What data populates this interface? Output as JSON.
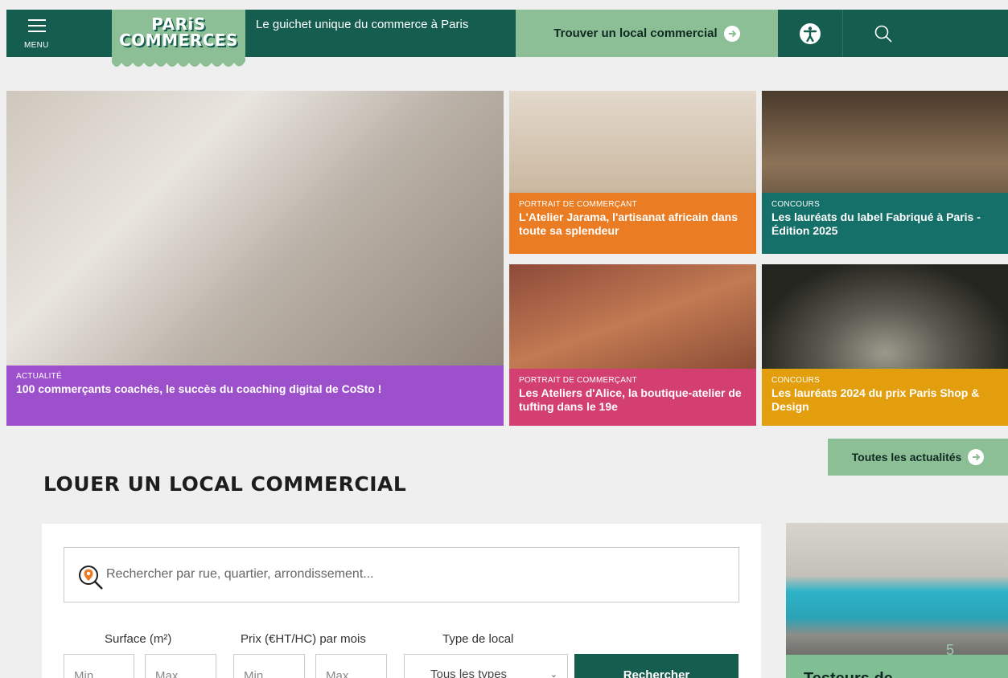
{
  "header": {
    "menu_label": "MENU",
    "logo_line1": "PARiS",
    "logo_line2": "COMMERCES",
    "tagline": "Le guichet unique du commerce à Paris",
    "cta_label": "Trouver un local commercial",
    "colors": {
      "primary": "#155e4f",
      "accent": "#8dbf97"
    }
  },
  "news": {
    "main": {
      "category": "ACTUALITÉ",
      "title": "100 commerçants coachés, le succès du coaching digital de CoSto !",
      "color": "#9d50cc"
    },
    "items": [
      {
        "category": "PORTRAIT DE COMMERÇANT",
        "title": "L'Atelier Jarama, l'artisanat africain dans toute sa splendeur",
        "color": "#ea7c23"
      },
      {
        "category": "CONCOURS",
        "title": "Les lauréats du label Fabriqué à Paris - Édition 2025",
        "color": "#16706a"
      },
      {
        "category": "PORTRAIT DE COMMERÇANT",
        "title": "Les Ateliers d'Alice, la boutique-atelier de tufting dans le 19e",
        "color": "#d23f70"
      },
      {
        "category": "CONCOURS",
        "title": "Les lauréats 2024 du prix Paris Shop & Design",
        "color": "#e29e0c"
      }
    ],
    "all_label": "Toutes les actualités"
  },
  "rent": {
    "title": "LOUER UN LOCAL COMMERCIAL",
    "search_placeholder": "Rechercher par rue, quartier, arrondissement...",
    "surface_label": "Surface (m²)",
    "price_label": "Prix (€HT/HC) par mois",
    "type_label": "Type de local",
    "min": "Min",
    "max": "Max",
    "type_value": "Tous les types",
    "submit": "Rechercher"
  },
  "side_card": {
    "number": "5",
    "title": "Testeurs de"
  }
}
